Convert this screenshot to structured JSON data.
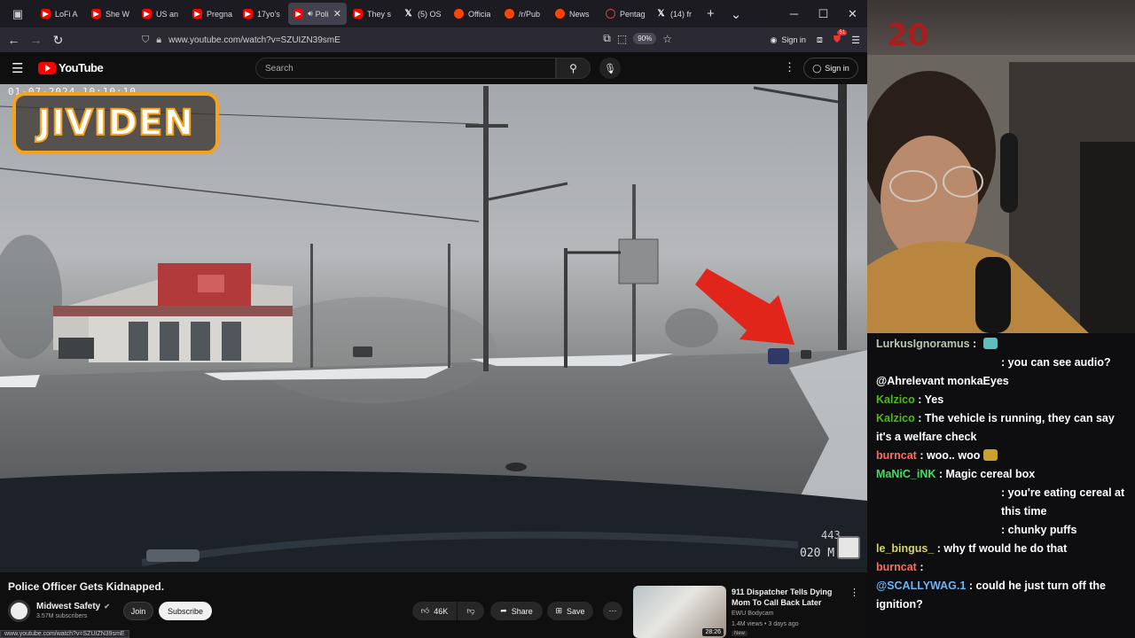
{
  "browser": {
    "tabs": [
      {
        "icon": "youtube",
        "title": "LoFi A",
        "active": false
      },
      {
        "icon": "youtube",
        "title": "She W",
        "active": false
      },
      {
        "icon": "youtube",
        "title": "US an",
        "active": false
      },
      {
        "icon": "youtube",
        "title": "Pregna",
        "active": false
      },
      {
        "icon": "youtube",
        "title": "17yo's",
        "active": false
      },
      {
        "icon": "youtube",
        "title": "Poli",
        "active": true
      },
      {
        "icon": "youtube",
        "title": "They s",
        "active": false
      },
      {
        "icon": "x",
        "title": "(5) OS",
        "active": false
      },
      {
        "icon": "reddit",
        "title": "Officia",
        "active": false
      },
      {
        "icon": "reddit",
        "title": "/r/Pub",
        "active": false
      },
      {
        "icon": "reddit",
        "title": "News",
        "active": false
      },
      {
        "icon": "pentagon",
        "title": "Pentag",
        "active": false
      },
      {
        "icon": "x",
        "title": "(14) fr",
        "active": false
      }
    ],
    "url": "www.youtube.com/watch?v=SZUIZN39smE",
    "zoom": "90%",
    "sign_in": "Sign in",
    "extension_badge": "51"
  },
  "youtube": {
    "logo_text": "YouTube",
    "search_placeholder": "Search",
    "sign_in": "Sign in"
  },
  "video": {
    "timestamp": "01-07-2024 10:10:10",
    "watermark": "JIVIDEN",
    "overlay_speed": "020 M",
    "overlay_num": "443",
    "title": "Police Officer Gets Kidnapped.",
    "channel": "Midwest Safety",
    "subscribers": "3.57M subscribers",
    "join": "Join",
    "subscribe": "Subscribe",
    "likes": "46K",
    "share": "Share",
    "save": "Save"
  },
  "status_url": "www.youtube.com/watch?v=SZUIZN39smE",
  "recommended": {
    "title": "911 Dispatcher Tells Dying Mom To Call Back Later",
    "channel": "EWU Bodycam",
    "meta": "1.4M views • 3 days ago",
    "badge": "New",
    "duration": "28:26"
  },
  "webcam": {
    "logo": "20"
  },
  "chat": [
    {
      "user": "LurkusIgnoramus",
      "color": "#b8c7b0",
      "text": "",
      "emote": "#5bc0be",
      "indent": false
    },
    {
      "user": "",
      "color": "#ffffff",
      "text": ": you can see audio?",
      "emote": "",
      "indent": true
    },
    {
      "user": "",
      "color": "#ffffff",
      "text": "@Ahrelevant monkaEyes",
      "emote": "",
      "indent": false
    },
    {
      "user": "Kalzico",
      "color": "#4cbb17",
      "text": "Yes",
      "emote": "",
      "indent": false
    },
    {
      "user": "Kalzico",
      "color": "#4cbb17",
      "text": "The vehicle is running, they can say it's a welfare check",
      "emote": "",
      "indent": false
    },
    {
      "user": "burncat",
      "color": "#ff6b5b",
      "text": "woo.. woo",
      "emote": "#c9a227",
      "indent": false
    },
    {
      "user": "MaNiC_iNK",
      "color": "#4cd964",
      "text": "Magic cereal box",
      "emote": "",
      "indent": false
    },
    {
      "user": "",
      "color": "#ffffff",
      "text": ": you're eating cereal at this time",
      "emote": "",
      "indent": true
    },
    {
      "user": "",
      "color": "#ffffff",
      "text": ": chunky puffs",
      "emote": "",
      "indent": true
    },
    {
      "user": "le_bingus_",
      "color": "#d4d46a",
      "text": "why tf would he do that",
      "emote": "",
      "indent": false
    },
    {
      "user": "burncat",
      "color": "#ff6b5b",
      "text": "",
      "emote": "",
      "indent": false
    },
    {
      "user": "",
      "color": "#ffffff",
      "text": ": could he just turn off the ignition?",
      "emote": "",
      "indent": false,
      "mention": "@SCALLYWAG.1",
      "mention_color": "#6db3f2"
    }
  ]
}
